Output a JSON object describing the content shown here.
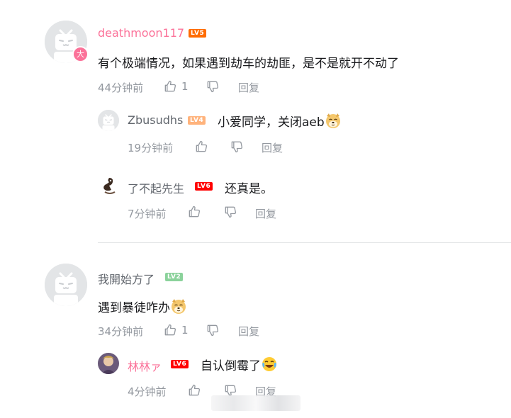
{
  "comments": [
    {
      "username": "deathmoon117",
      "level": "LV5",
      "avatar_badge": "大",
      "text": "有个极端情况，如果遇到劫车的劫匪，是不是就开不动了",
      "time": "44分钟前",
      "likes": "1",
      "reply_label": "回复",
      "replies": [
        {
          "username": "Zbusudhs",
          "level": "LV4",
          "text": "小爱同学，关闭aeb",
          "time": "19分钟前",
          "reply_label": "回复"
        },
        {
          "username": "了不起先生",
          "level": "LV6",
          "text": "还真是。",
          "time": "7分钟前",
          "reply_label": "回复"
        }
      ]
    },
    {
      "username": "我開始方了",
      "level": "LV2",
      "text": "遇到暴徒咋办",
      "time": "34分钟前",
      "likes": "1",
      "reply_label": "回复",
      "replies": [
        {
          "username": "林林ァ",
          "level": "LV6",
          "text": "自认倒霉了",
          "time": "4分钟前",
          "reply_label": "回复"
        }
      ]
    }
  ],
  "colors": {
    "pink_name": "#fb7299",
    "gray_text": "#9499a0",
    "lv2": "#8bd29b",
    "lv4": "#ffb37c",
    "lv5": "#ff6c00",
    "lv6": "#ff0000"
  },
  "icons": [
    "thumb-up-icon",
    "thumb-down-icon",
    "doge-emoji-icon",
    "cry-laugh-emoji-icon"
  ]
}
